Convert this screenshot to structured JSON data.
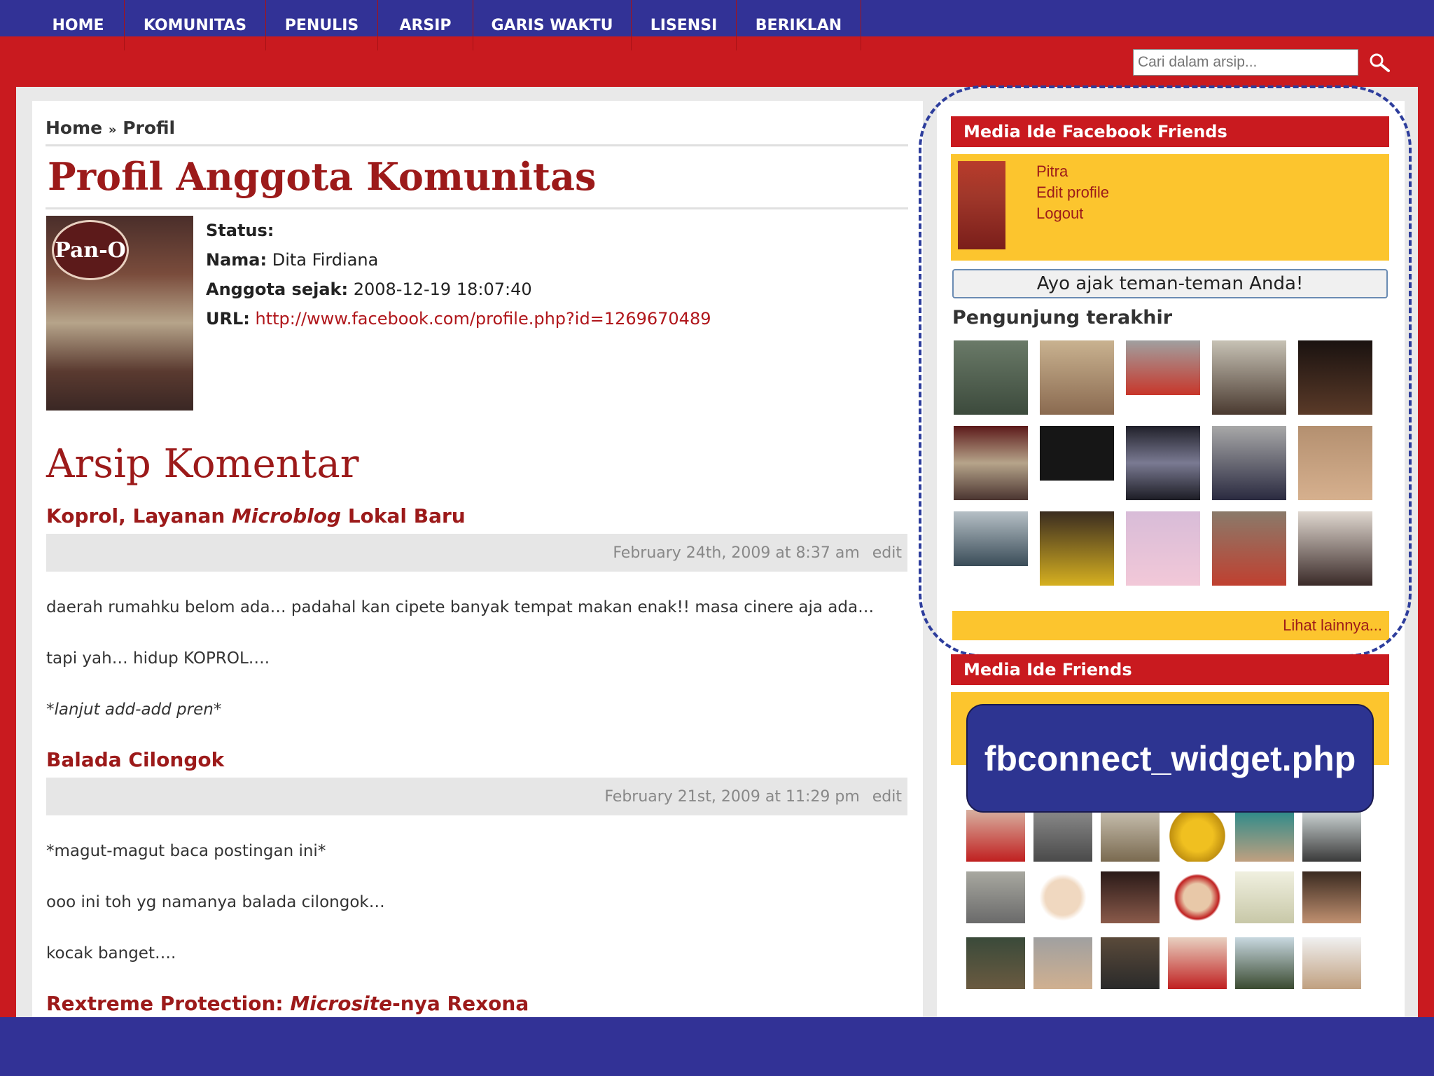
{
  "nav": {
    "items": [
      "HOME",
      "KOMUNITAS",
      "PENULIS",
      "ARSIP",
      "GARIS WAKTU",
      "LISENSI",
      "BERIKLAN"
    ],
    "search_placeholder": "Cari dalam arsip..."
  },
  "breadcrumb": {
    "home": "Home",
    "separator": "»",
    "current": "Profil"
  },
  "profile": {
    "title": "Profil Anggota Komunitas",
    "photo_text": "Pan-O",
    "status_label": "Status:",
    "name_label": "Nama:",
    "name_value": "Dita Firdiana",
    "member_since_label": "Anggota sejak:",
    "member_since_value": "2008-12-19 18:07:40",
    "url_label": "URL:",
    "url_value": "http://www.facebook.com/profile.php?id=1269670489"
  },
  "comments_archive": {
    "title": "Arsip Komentar",
    "posts": [
      {
        "title_a": "Koprol, Layanan ",
        "title_em": "Microblog",
        "title_b": " Lokal Baru",
        "date": "February 24th, 2009 at 8:37 am",
        "edit": "edit",
        "lines": [
          "daerah rumahku belom ada… padahal kan cipete banyak tempat makan enak!! masa cinere aja ada…",
          "tapi yah… hidup KOPROL….",
          "*lanjut add-add pren*"
        ]
      },
      {
        "title_a": "Balada Cilongok",
        "date": "February 21st, 2009 at 11:29 pm",
        "edit": "edit",
        "lines": [
          "*magut-magut baca postingan ini*",
          "ooo ini toh yg namanya balada cilongok…",
          "kocak banget…."
        ]
      },
      {
        "title_a": "Rextreme Protection: ",
        "title_em": "Microsite",
        "title_b": "-nya Rexona"
      }
    ]
  },
  "sidebar": {
    "fb_widget": {
      "title": "Media Ide Facebook Friends",
      "user_name": "Pitra",
      "edit_profile": "Edit profile",
      "logout": "Logout",
      "invite_button": "Ayo ajak teman-teman Anda!",
      "recent_visitors_title": "Pengunjung terakhir",
      "see_more": "Lihat lainnya..."
    },
    "friends_widget": {
      "title": "Media Ide Friends"
    },
    "callout": "fbconnect_widget.php"
  },
  "colors": {
    "brand_red": "#c91a1f",
    "title_red": "#9c1a1a",
    "accent_yellow": "#fcc52e",
    "frame_blue": "#323296"
  }
}
